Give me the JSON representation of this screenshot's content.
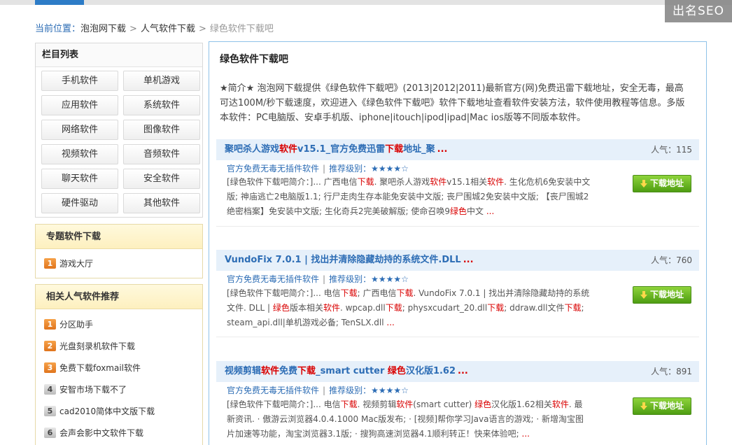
{
  "seo_badge": "出名SEO",
  "breadcrumb": {
    "label": "当前位置：",
    "items": [
      "泡泡网下载",
      "人气软件下载"
    ],
    "separator": ">",
    "current": "绿色软件下载吧"
  },
  "sidebar": {
    "categories_title": "栏目列表",
    "categories": [
      "手机软件",
      "单机游戏",
      "应用软件",
      "系统软件",
      "网络软件",
      "图像软件",
      "视频软件",
      "音频软件",
      "聊天软件",
      "安全软件",
      "硬件驱动",
      "其他软件"
    ],
    "topic_title": "专题软件下载",
    "topic_items": [
      {
        "num": "1",
        "label": "游戏大厅"
      }
    ],
    "recommend_title": "相关人气软件推荐",
    "recommend_items": [
      {
        "num": "1",
        "label": "分区助手"
      },
      {
        "num": "2",
        "label": "光盘刻录机软件下载"
      },
      {
        "num": "3",
        "label": "免费下载foxmail软件"
      },
      {
        "num": "4",
        "label": "安智市场下载不了"
      },
      {
        "num": "5",
        "label": "cad2010简体中文版下载"
      },
      {
        "num": "6",
        "label": "会声会影中文软件下载"
      }
    ]
  },
  "main": {
    "title": "绿色软件下载吧",
    "intro": "★简介★ 泡泡网下载提供《绿色软件下载吧》(2013|2012|2011)最新官方(网)免费迅雷下载地址，安全无毒，最高可达100M/秒下载速度，欢迎进入《绿色软件下载吧》软件下载地址查看软件安装方法，软件使用教程等信息。多版本软件：PC电脑版、安卓手机版、iphone|itouch|ipod|ipad|Mac ios版等不同版本软件。",
    "popularity_label": "人气：",
    "meta_text": "官方免费无毒无插件软件",
    "meta_separator": "|",
    "rating_label": "推荐级别：★★★★☆",
    "download_label": "下载地址",
    "more": "...",
    "items": [
      {
        "title_parts": [
          "聚吧杀人游戏",
          "软件",
          "v15.1_官方免费迅雷",
          "下载",
          "地址_聚"
        ],
        "popularity": "115",
        "desc_parts": [
          "[绿色软件下载吧简介：]... 广西电信",
          "下载",
          ". 聚吧杀人游戏",
          "软件",
          "v15.1相关",
          "软件",
          ". 生化危机6免安装中文版; 神庙逃亡2电脑版1.1; 行尸走肉生存本能免安装中文版; 丧尸围城2免安装中文版; 【丧尸围城2绝密档案】免安装中文版; 生化奇兵2完美破解版; 使命召唤9",
          "绿色",
          "中文"
        ]
      },
      {
        "title_parts": [
          "VundoFix 7.0.1 | 找出并清除隐藏劫持的系统文件.DLL"
        ],
        "popularity": "760",
        "desc_parts": [
          "[绿色软件下载吧简介：]... 电信",
          "下载",
          "; 广西电信",
          "下载",
          ". VundoFix 7.0.1 | 找出并清除隐藏劫持的系统文件. DLL | ",
          "绿色",
          "版本相关",
          "软件",
          ". wpcap.dll",
          "下载",
          "; physxcudart_20.dll",
          "下载",
          "; ddraw.dll文件",
          "下载",
          "; steam_api.dll|单机游戏必备; TenSLX.dll"
        ]
      },
      {
        "title_parts": [
          "视频剪辑",
          "软件",
          "免费",
          "下载",
          "_smart cutter ",
          "绿色",
          "汉化版1.62"
        ],
        "popularity": "891",
        "desc_parts": [
          "[绿色软件下载吧简介：]... 电信",
          "下载",
          ". 视频剪辑",
          "软件",
          "(smart cutter) ",
          "绿色",
          "汉化版1.62相关",
          "软件",
          ". 最新资讯. · 傲游云浏览器4.0.4.1000 Mac版发布; · [视频]帮你学习Java语言的游戏; · 新增淘宝图片加速等功能，淘宝浏览器3.1版; · 搜狗高速浏览器4.1顺利转正！快来体验吧;"
        ]
      }
    ]
  }
}
